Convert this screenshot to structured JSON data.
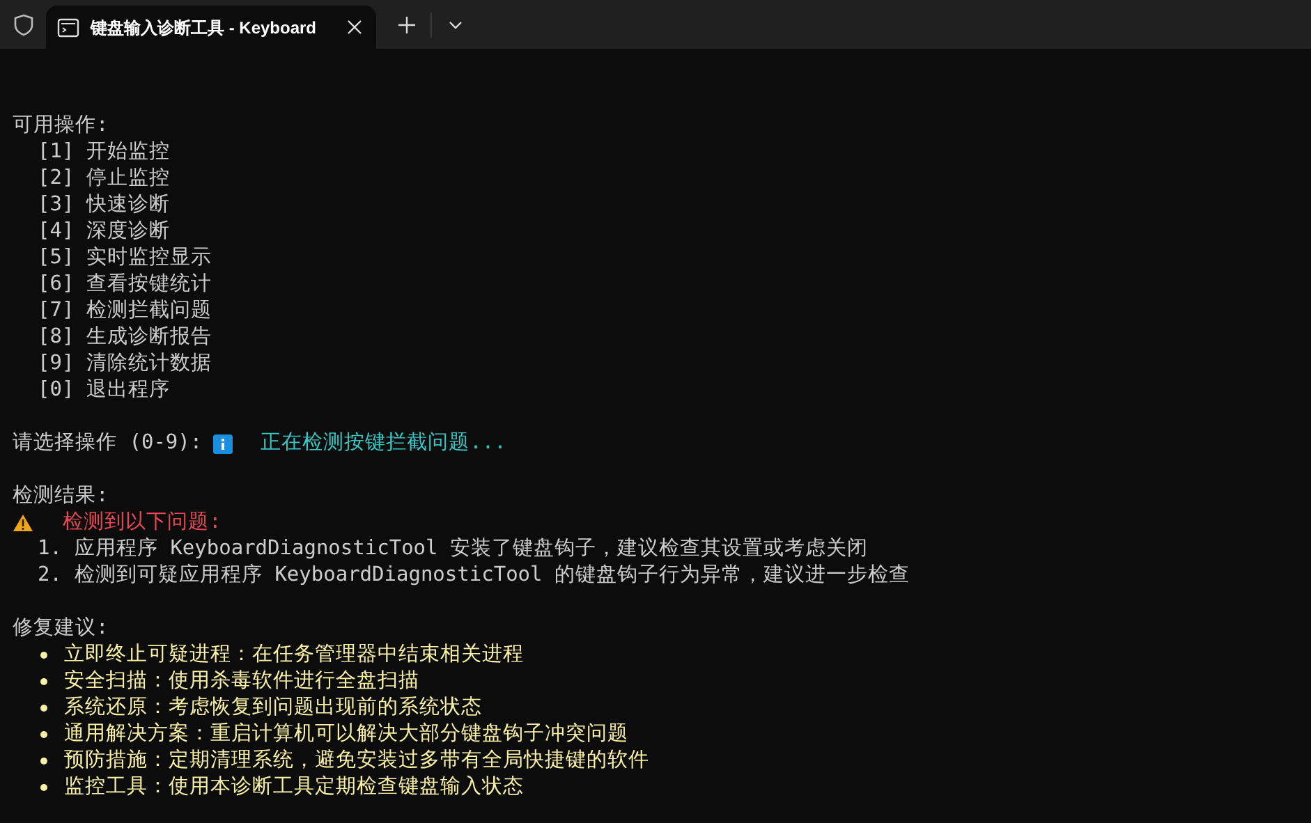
{
  "tab": {
    "title": "键盘输入诊断工具 - Keyboard",
    "selected": true
  },
  "menu": {
    "heading": "可用操作:",
    "options": [
      "[1] 开始监控",
      "[2] 停止监控",
      "[3] 快速诊断",
      "[4] 深度诊断",
      "[5] 实时监控显示",
      "[6] 查看按键统计",
      "[7] 检测拦截问题",
      "[8] 生成诊断报告",
      "[9] 清除统计数据",
      "[0] 退出程序"
    ]
  },
  "prompt": {
    "text": "请选择操作 (0-9):",
    "status": "正在检测按键拦截问题..."
  },
  "results": {
    "heading": "检测结果:",
    "warning": "检测到以下问题:",
    "issues": [
      {
        "number": "1.",
        "text": "应用程序 KeyboardDiagnosticTool 安装了键盘钩子，建议检查其设置或考虑关闭"
      },
      {
        "number": "2.",
        "text": "检测到可疑应用程序 KeyboardDiagnosticTool 的键盘钩子行为异常，建议进一步检查"
      }
    ]
  },
  "suggestions": {
    "heading": "修复建议:",
    "items": [
      "立即终止可疑进程：在任务管理器中结束相关进程",
      "安全扫描：使用杀毒软件进行全盘扫描",
      "系统还原：考虑恢复到问题出现前的系统状态",
      "通用解决方案：重启计算机可以解决大部分键盘钩子冲突问题",
      "预防措施：定期清理系统，避免安装过多带有全局快捷键的软件",
      "监控工具：使用本诊断工具定期检查键盘输入状态"
    ]
  }
}
